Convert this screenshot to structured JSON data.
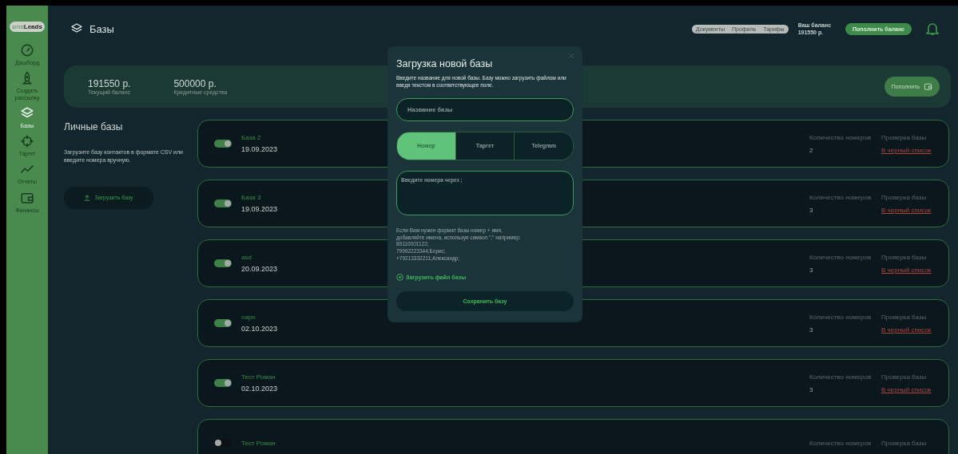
{
  "sidebar": {
    "logo": {
      "part1": "sms",
      "part2": "Leads"
    },
    "items": [
      {
        "label": "Дашборд",
        "selected": false
      },
      {
        "label": "Создать рассылку",
        "selected": false
      },
      {
        "label": "Базы",
        "selected": true
      },
      {
        "label": "Таргет",
        "selected": false
      },
      {
        "label": "Отчеты",
        "selected": false
      },
      {
        "label": "Финансы",
        "selected": false
      }
    ]
  },
  "header": {
    "title": "Базы",
    "nav": [
      "Документы",
      "Профиль",
      "Тарифы"
    ],
    "balance_label": "Ваш баланс",
    "balance_value": "191550 р.",
    "topup_button": "Пополнить баланс"
  },
  "balance_card": {
    "stats": [
      {
        "value": "191550 р.",
        "label": "Текущий баланс"
      },
      {
        "value": "500000 р.",
        "label": "Кредитные средства"
      }
    ],
    "button": "Пополнить"
  },
  "personal": {
    "title": "Личные базы",
    "description": "Загрузите базу контактов в формате CSV или введите номера вручную.",
    "upload_button": "Загрузить базу"
  },
  "bases": [
    {
      "name": "База 2",
      "date": "19.09.2023",
      "on": true,
      "count_label": "Количество номеров",
      "count": "2",
      "check_label": "Проверка базы",
      "link": "В черный список"
    },
    {
      "name": "База 3",
      "date": "19.09.2023",
      "on": true,
      "count_label": "Количество номеров",
      "count": "3",
      "check_label": "Проверка базы",
      "link": "В черный список"
    },
    {
      "name": "asd",
      "date": "20.09.2023",
      "on": true,
      "count_label": "Количество номеров",
      "count": "3",
      "check_label": "Проверка базы",
      "link": "В черный список"
    },
    {
      "name": "napn",
      "date": "02.10.2023",
      "on": true,
      "count_label": "Количество номеров",
      "count": "3",
      "check_label": "Проверка базы",
      "link": "В черный список"
    },
    {
      "name": "Тест Роман",
      "date": "02.10.2023",
      "on": true,
      "count_label": "Количество номеров",
      "count": "3",
      "check_label": "Проверка базы",
      "link": "В черный список"
    },
    {
      "name": "Тест Роман",
      "on": false,
      "count_label": "Количество номеров",
      "check_label": "Проверка базы"
    }
  ],
  "modal": {
    "title": "Загрузка новой базы",
    "description": "Введите название для новой базы. Базу можно загрузить файлом или введя текстом в соответствующее поле.",
    "name_placeholder": "Название базы",
    "tabs": [
      {
        "label": "Номер",
        "selected": true
      },
      {
        "label": "Таргет",
        "selected": false
      },
      {
        "label": "Telegram",
        "selected": false
      }
    ],
    "numbers_placeholder": "Введите номера через ;",
    "hint": [
      "Если Вам нужен формат базы номер + имя,",
      "добавляйте имена, используя символ \";\" например:",
      "89110001122;",
      "79992223344;Борис;",
      "+79213332211;Александр;"
    ],
    "file_link": "Загрузить файл базы",
    "save_button": "Сохранить базу"
  }
}
